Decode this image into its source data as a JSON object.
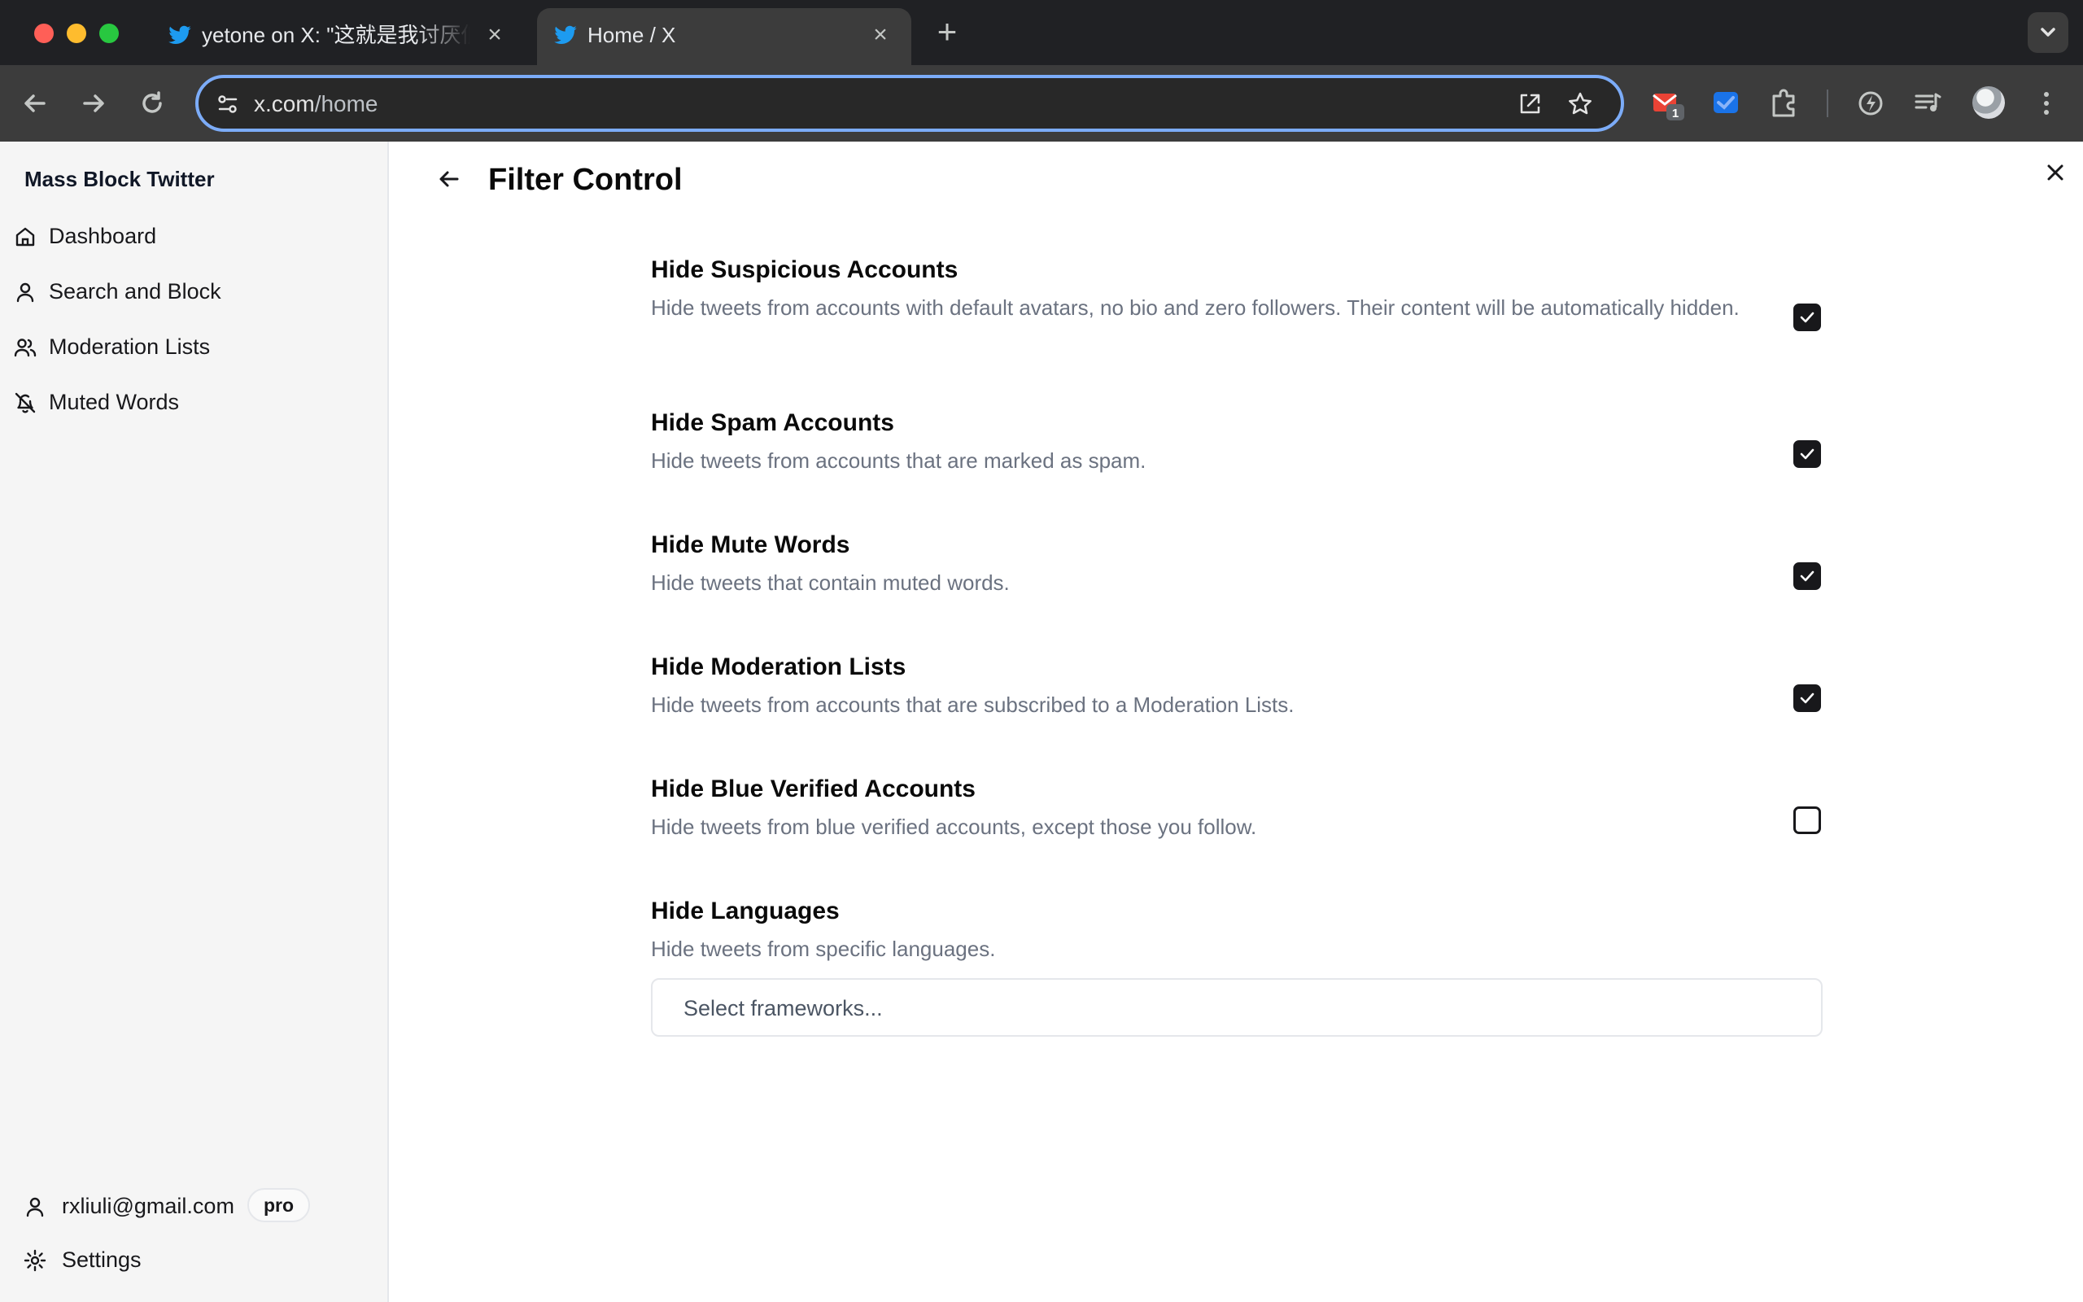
{
  "browser": {
    "tabs": [
      {
        "title": "yetone on X: \"这就是我讨厌低俗",
        "active": false
      },
      {
        "title": "Home / X",
        "active": true
      }
    ],
    "new_tab_label": "+",
    "url_host": "x.com",
    "url_path": "/home",
    "extensions": [
      {
        "icon": "gmail-extension-icon",
        "badge": "1"
      },
      {
        "icon": "translate-extension-icon"
      },
      {
        "icon": "puzzle-icon"
      },
      {
        "icon": "performance-icon"
      },
      {
        "icon": "reading-list-icon"
      }
    ]
  },
  "app": {
    "brand": "Mass Block Twitter",
    "nav": [
      {
        "label": "Dashboard",
        "icon": "home-icon"
      },
      {
        "label": "Search and Block",
        "icon": "user-icon"
      },
      {
        "label": "Moderation Lists",
        "icon": "users-icon"
      },
      {
        "label": "Muted Words",
        "icon": "bell-off-icon"
      }
    ],
    "account": {
      "email": "rxliuli@gmail.com",
      "plan": "pro"
    },
    "settings_label": "Settings"
  },
  "main": {
    "title": "Filter Control",
    "settings": [
      {
        "title": "Hide Suspicious Accounts",
        "description": "Hide tweets from accounts with default avatars, no bio and zero followers. Their content will be automatically hidden.",
        "checked": true
      },
      {
        "title": "Hide Spam Accounts",
        "description": "Hide tweets from accounts that are marked as spam.",
        "checked": true
      },
      {
        "title": "Hide Mute Words",
        "description": "Hide tweets that contain muted words.",
        "checked": true
      },
      {
        "title": "Hide Moderation Lists",
        "description": "Hide tweets from accounts that are subscribed to a Moderation Lists.",
        "checked": true
      },
      {
        "title": "Hide Blue Verified Accounts",
        "description": "Hide tweets from blue verified accounts, except those you follow.",
        "checked": false
      }
    ],
    "languages": {
      "title": "Hide Languages",
      "description": "Hide tweets from specific languages.",
      "placeholder": "Select frameworks..."
    }
  },
  "colors": {
    "accent": "#18181b",
    "muted_text": "#6b7280",
    "focus_ring": "#7cacf8",
    "twitter_blue": "#1d9bf0"
  }
}
